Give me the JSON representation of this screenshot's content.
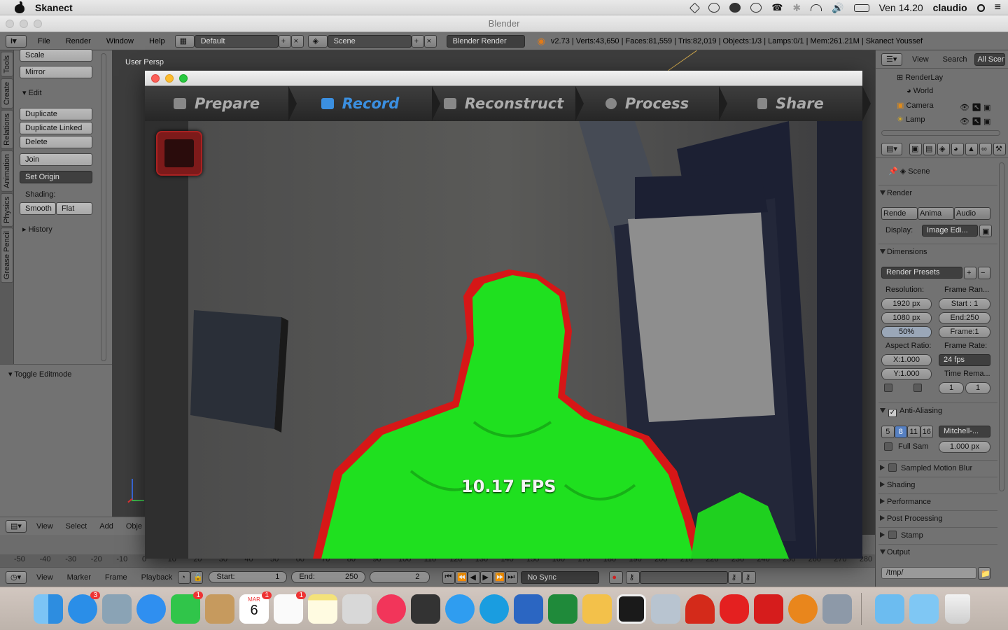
{
  "menubar": {
    "app": "Skanect",
    "time": "Ven 14.20",
    "user": "claudio"
  },
  "window": {
    "title": "Blender"
  },
  "info": {
    "menus": [
      "File",
      "Render",
      "Window",
      "Help"
    ],
    "layout": "Default",
    "scene": "Scene",
    "engine": "Blender Render",
    "stats": "v2.73 | Verts:43,650 | Faces:81,559 | Tris:82,019 | Objects:1/3 | Lamps:0/1 | Mem:261.21M | Skanect Youssef"
  },
  "tabs": [
    "Tools",
    "Create",
    "Relations",
    "Animation",
    "Physics",
    "Grease Pencil"
  ],
  "shelf": {
    "scale": "Scale",
    "mirror": "Mirror",
    "edit": "Edit",
    "duplicate": "Duplicate",
    "duplicate_linked": "Duplicate Linked",
    "delete": "Delete",
    "join": "Join",
    "set_origin": "Set Origin",
    "shading": "Shading:",
    "smooth": "Smooth",
    "flat": "Flat",
    "history": "History",
    "toggle": "Toggle Editmode"
  },
  "viewport": {
    "label": "User Persp",
    "menus": [
      "View",
      "Select",
      "Add",
      "Obje"
    ]
  },
  "skanect": {
    "nav": [
      "Prepare",
      "Record",
      "Reconstruct",
      "Process",
      "Share"
    ],
    "active": "Record",
    "fps": "10.17 FPS"
  },
  "outliner": {
    "view": "View",
    "search": "Search",
    "scope": "All Scen",
    "items": [
      "RenderLay",
      "World",
      "Camera",
      "Lamp"
    ]
  },
  "props": {
    "scene": "Scene",
    "render": "Render",
    "render_buttons": [
      "Rende",
      "Anima",
      "Audio"
    ],
    "display_label": "Display:",
    "display_value": "Image Edi...",
    "dimensions": "Dimensions",
    "presets": "Render Presets",
    "resolution": "Resolution:",
    "frame_range": "Frame Ran...",
    "res_x": "1920 px",
    "res_y": "1080 px",
    "res_pct": "50%",
    "start": "Start : 1",
    "end": "End:250",
    "frame": "Frame:1",
    "aspect": "Aspect Ratio:",
    "frame_rate": "Frame Rate:",
    "ax": "X:1.000",
    "ay": "Y:1.000",
    "fps": "24 fps",
    "time_remap": "Time Rema...",
    "remap_a": "1",
    "remap_b": "1",
    "aa": "Anti-Aliasing",
    "aa_samples": [
      "5",
      "8",
      "11",
      "16"
    ],
    "filter": "Mitchell-...",
    "full_sample": "Full Sam",
    "filter_size": "1.000 px",
    "panels": [
      "Sampled Motion Blur",
      "Shading",
      "Performance",
      "Post Processing",
      "Stamp"
    ],
    "output": "Output",
    "path": "/tmp/"
  },
  "timeline": {
    "menus": [
      "View",
      "Marker",
      "Frame",
      "Playback"
    ],
    "start": "Start:",
    "start_val": "1",
    "end": "End:",
    "end_val": "250",
    "current": "2",
    "sync": "No Sync",
    "ruler": [
      "-50",
      "-40",
      "-30",
      "-20",
      "-10",
      "0",
      "10",
      "20",
      "30",
      "40",
      "50",
      "60",
      "70",
      "80",
      "90",
      "100",
      "110",
      "120",
      "130",
      "140",
      "150",
      "160",
      "170",
      "180",
      "190",
      "200",
      "210",
      "220",
      "230",
      "240",
      "250",
      "260",
      "270",
      "280"
    ]
  },
  "dock": {
    "calendar_month": "MAR",
    "calendar_day": "6",
    "badges": {
      "appstore": "3",
      "facetime": "1",
      "calendar": "1",
      "reminders": "1"
    }
  }
}
